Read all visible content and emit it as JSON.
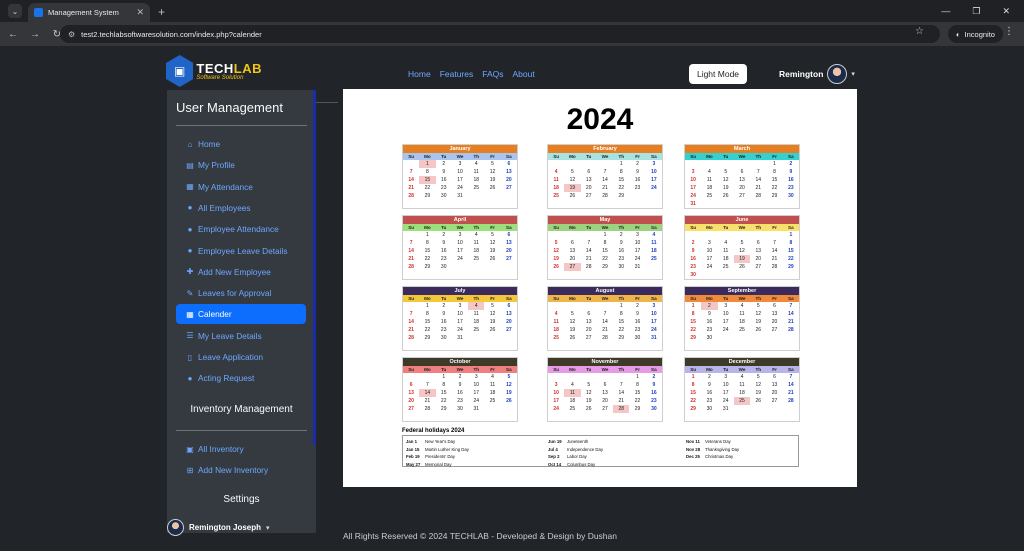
{
  "browser": {
    "tab_title": "Management System",
    "url": "test2.techlabsoftwaresolution.com/index.php?calender",
    "incognito_label": "Incognito"
  },
  "brand": {
    "name_a": "TECH",
    "name_b": "LAB",
    "tagline": "Software Solution",
    "accent": "#f0c419"
  },
  "nav": {
    "links": [
      "Home",
      "Features",
      "FAQs",
      "About"
    ],
    "mode_button": "Light Mode",
    "user_name": "Remington"
  },
  "sidebar": {
    "title": "User Management",
    "items": [
      {
        "label": "Home",
        "icon": "home-icon",
        "glyph": "⌂"
      },
      {
        "label": "My Profile",
        "icon": "id-card-icon",
        "glyph": "▤"
      },
      {
        "label": "My Attendance",
        "icon": "calendar-icon",
        "glyph": "▦"
      },
      {
        "label": "All Employees",
        "icon": "user-icon",
        "glyph": "●"
      },
      {
        "label": "Employee Attendance",
        "icon": "user-icon",
        "glyph": "●"
      },
      {
        "label": "Employee Leave Details",
        "icon": "user-icon",
        "glyph": "●"
      },
      {
        "label": "Add New Employee",
        "icon": "user-plus-icon",
        "glyph": "✚"
      },
      {
        "label": "Leaves for Approval",
        "icon": "file-signature-icon",
        "glyph": "✎"
      },
      {
        "label": "Calender",
        "icon": "calendar-icon",
        "glyph": "▦",
        "active": true
      },
      {
        "label": "My Leave Details",
        "icon": "list-icon",
        "glyph": "☰"
      },
      {
        "label": "Leave Application",
        "icon": "file-icon",
        "glyph": "▯"
      },
      {
        "label": "Acting Request",
        "icon": "user-clock-icon",
        "glyph": "●"
      }
    ],
    "inventory_title": "Inventory Management",
    "inventory_items": [
      {
        "label": "All Inventory",
        "icon": "warehouse-icon",
        "glyph": "▣"
      },
      {
        "label": "Add New Inventory",
        "icon": "plus-square-icon",
        "glyph": "⊞"
      }
    ],
    "settings_title": "Settings",
    "footer_user": "Remington Joseph"
  },
  "calendar": {
    "year": "2024",
    "weekdays": [
      "Su",
      "Mo",
      "Tu",
      "We",
      "Th",
      "Fr",
      "Sa"
    ],
    "months": [
      {
        "name": "January",
        "color": "#e67e22",
        "wk": "#a9c5ef",
        "start": 1,
        "days": 31,
        "holidays": [
          1,
          15
        ]
      },
      {
        "name": "February",
        "color": "#e67e22",
        "wk": "#a8e2e2",
        "start": 4,
        "days": 29,
        "holidays": [
          19
        ]
      },
      {
        "name": "March",
        "color": "#e67e22",
        "wk": "#35d0d0",
        "start": 5,
        "days": 31,
        "holidays": []
      },
      {
        "name": "April",
        "color": "#c0504d",
        "wk": "#9be07a",
        "start": 1,
        "days": 30,
        "holidays": []
      },
      {
        "name": "May",
        "color": "#c0504d",
        "wk": "#9bd37f",
        "start": 3,
        "days": 31,
        "holidays": [
          27
        ]
      },
      {
        "name": "June",
        "color": "#c0504d",
        "wk": "#f7e16b",
        "start": 6,
        "days": 30,
        "holidays": [
          19
        ]
      },
      {
        "name": "July",
        "color": "#3b2a5c",
        "wk": "#f5c83a",
        "start": 1,
        "days": 31,
        "holidays": [
          4
        ]
      },
      {
        "name": "August",
        "color": "#3b2a5c",
        "wk": "#f0b54a",
        "start": 4,
        "days": 31,
        "holidays": []
      },
      {
        "name": "September",
        "color": "#3b2a5c",
        "wk": "#f08a3a",
        "start": 0,
        "days": 30,
        "holidays": [
          2
        ]
      },
      {
        "name": "October",
        "color": "#3d3a28",
        "wk": "#f08080",
        "start": 2,
        "days": 31,
        "holidays": [
          14
        ]
      },
      {
        "name": "November",
        "color": "#3d3a28",
        "wk": "#e79be7",
        "start": 5,
        "days": 30,
        "holidays": [
          11,
          28
        ]
      },
      {
        "name": "December",
        "color": "#3d3a28",
        "wk": "#b8b3e8",
        "start": 0,
        "days": 31,
        "holidays": [
          25
        ]
      }
    ],
    "federal_title": "Federal holidays 2024",
    "federal_holidays": [
      [
        [
          "Jan 1",
          "New Year's Day"
        ],
        [
          "Jan 15",
          "Martin Luther King Day"
        ],
        [
          "Feb 19",
          "Presidents' Day"
        ],
        [
          "May 27",
          "Memorial Day"
        ]
      ],
      [
        [
          "Jun 19",
          "Juneteenth"
        ],
        [
          "Jul 4",
          "Independence Day"
        ],
        [
          "Sep 2",
          "Labor Day"
        ],
        [
          "Oct 14",
          "Columbus Day"
        ]
      ],
      [
        [
          "Nov 11",
          "Veterans Day"
        ],
        [
          "Nov 28",
          "Thanksgiving Day"
        ],
        [
          "Dec 25",
          "Christmas Day"
        ]
      ]
    ]
  },
  "footer": {
    "text": "All Rights Reserved © 2024 TECHLAB - Developed & Design by Dushan"
  }
}
